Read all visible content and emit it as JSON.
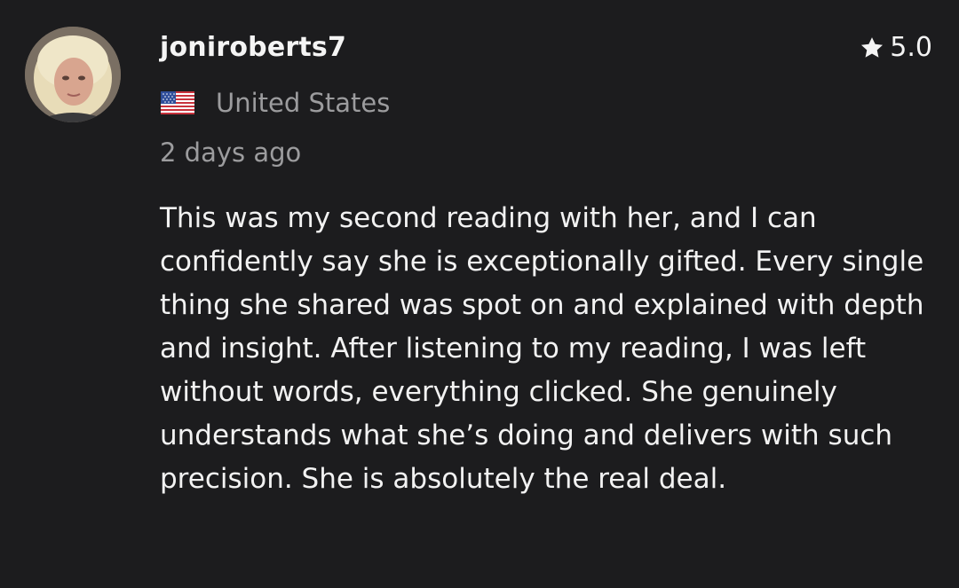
{
  "review": {
    "username": "joniroberts7",
    "rating": "5.0",
    "country": "United States",
    "flag_icon": "us-flag-icon",
    "time_ago": "2 days ago",
    "text": "This was my second reading with her, and I can confidently say she is exceptionally gifted. Every single thing she shared was spot on and explained with depth and insight. After listening to my reading, I was left without words, everything clicked. She genuinely understands what she’s doing and delivers with such precision. She is absolutely the real deal."
  },
  "colors": {
    "background": "#1c1c1e",
    "primary_text": "#f2f2f2",
    "secondary_text": "#9c9c9e"
  }
}
